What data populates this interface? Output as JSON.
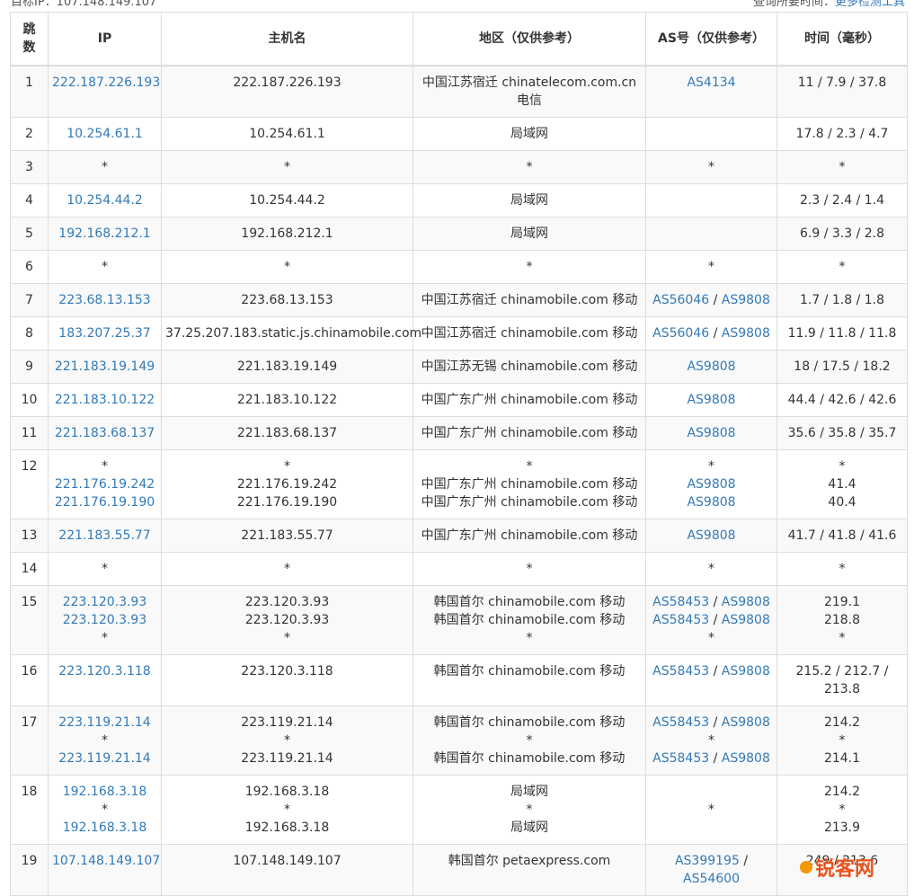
{
  "top": {
    "left_text": "目标IP：107.148.149.107",
    "right_text": "查询所要时间：",
    "right_link": "更多检测工具"
  },
  "headers": {
    "hop_line1": "跳",
    "hop_line2": "数",
    "ip": "IP",
    "host": "主机名",
    "region": "地区（仅供参考）",
    "as": "AS号（仅供参考）",
    "time": "时间（毫秒）"
  },
  "rows": [
    {
      "hop": "1",
      "ip": [
        "222.187.226.193"
      ],
      "host": [
        "222.187.226.193"
      ],
      "region": [
        "中国江苏宿迁 chinatelecom.com.cn",
        "电信"
      ],
      "as": [
        [
          "AS4134"
        ]
      ],
      "time": [
        "11 / 7.9 / 37.8"
      ]
    },
    {
      "hop": "2",
      "ip": [
        "10.254.61.1"
      ],
      "host": [
        "10.254.61.1"
      ],
      "region": [
        "局域网"
      ],
      "as": [
        []
      ],
      "time": [
        "17.8 / 2.3 / 4.7"
      ]
    },
    {
      "hop": "3",
      "ip": [
        "*"
      ],
      "host": [
        "*"
      ],
      "region": [
        "*"
      ],
      "as": [
        [
          "*"
        ]
      ],
      "time": [
        "*"
      ]
    },
    {
      "hop": "4",
      "ip": [
        "10.254.44.2"
      ],
      "host": [
        "10.254.44.2"
      ],
      "region": [
        "局域网"
      ],
      "as": [
        []
      ],
      "time": [
        "2.3 / 2.4 / 1.4"
      ]
    },
    {
      "hop": "5",
      "ip": [
        "192.168.212.1"
      ],
      "host": [
        "192.168.212.1"
      ],
      "region": [
        "局域网"
      ],
      "as": [
        []
      ],
      "time": [
        "6.9 / 3.3 / 2.8"
      ]
    },
    {
      "hop": "6",
      "ip": [
        "*"
      ],
      "host": [
        "*"
      ],
      "region": [
        "*"
      ],
      "as": [
        [
          "*"
        ]
      ],
      "time": [
        "*"
      ]
    },
    {
      "hop": "7",
      "ip": [
        "223.68.13.153"
      ],
      "host": [
        "223.68.13.153"
      ],
      "region": [
        "中国江苏宿迁 chinamobile.com 移动"
      ],
      "as": [
        [
          "AS56046",
          "AS9808"
        ]
      ],
      "time": [
        "1.7 / 1.8 / 1.8"
      ]
    },
    {
      "hop": "8",
      "ip": [
        "183.207.25.37"
      ],
      "host": [
        "37.25.207.183.static.js.chinamobile.com"
      ],
      "region": [
        "中国江苏宿迁 chinamobile.com 移动"
      ],
      "as": [
        [
          "AS56046",
          "AS9808"
        ]
      ],
      "time": [
        "11.9 / 11.8 / 11.8"
      ]
    },
    {
      "hop": "9",
      "ip": [
        "221.183.19.149"
      ],
      "host": [
        "221.183.19.149"
      ],
      "region": [
        "中国江苏无锡 chinamobile.com 移动"
      ],
      "as": [
        [
          "AS9808"
        ]
      ],
      "time": [
        "18 / 17.5 / 18.2"
      ]
    },
    {
      "hop": "10",
      "ip": [
        "221.183.10.122"
      ],
      "host": [
        "221.183.10.122"
      ],
      "region": [
        "中国广东广州 chinamobile.com 移动"
      ],
      "as": [
        [
          "AS9808"
        ]
      ],
      "time": [
        "44.4 / 42.6 / 42.6"
      ]
    },
    {
      "hop": "11",
      "ip": [
        "221.183.68.137"
      ],
      "host": [
        "221.183.68.137"
      ],
      "region": [
        "中国广东广州 chinamobile.com 移动"
      ],
      "as": [
        [
          "AS9808"
        ]
      ],
      "time": [
        "35.6 / 35.8 / 35.7"
      ]
    },
    {
      "hop": "12",
      "ip": [
        "*",
        "221.176.19.242",
        "221.176.19.190"
      ],
      "host": [
        "*",
        "221.176.19.242",
        "221.176.19.190"
      ],
      "region": [
        "*",
        "中国广东广州 chinamobile.com 移动",
        "中国广东广州 chinamobile.com 移动"
      ],
      "as": [
        [
          "*"
        ],
        [
          "AS9808"
        ],
        [
          "AS9808"
        ]
      ],
      "time": [
        "*",
        "41.4",
        "40.4"
      ]
    },
    {
      "hop": "13",
      "ip": [
        "221.183.55.77"
      ],
      "host": [
        "221.183.55.77"
      ],
      "region": [
        "中国广东广州 chinamobile.com 移动"
      ],
      "as": [
        [
          "AS9808"
        ]
      ],
      "time": [
        "41.7 / 41.8 / 41.6"
      ]
    },
    {
      "hop": "14",
      "ip": [
        "*"
      ],
      "host": [
        "*"
      ],
      "region": [
        "*"
      ],
      "as": [
        [
          "*"
        ]
      ],
      "time": [
        "*"
      ]
    },
    {
      "hop": "15",
      "ip": [
        "223.120.3.93",
        "223.120.3.93",
        "*"
      ],
      "host": [
        "223.120.3.93",
        "223.120.3.93",
        "*"
      ],
      "region": [
        "韩国首尔 chinamobile.com 移动",
        "韩国首尔 chinamobile.com 移动",
        "*"
      ],
      "as": [
        [
          "AS58453",
          "AS9808"
        ],
        [
          "AS58453",
          "AS9808"
        ],
        [
          "*"
        ]
      ],
      "time": [
        "219.1",
        "218.8",
        "*"
      ]
    },
    {
      "hop": "16",
      "ip": [
        "223.120.3.118"
      ],
      "host": [
        "223.120.3.118"
      ],
      "region": [
        "韩国首尔 chinamobile.com 移动"
      ],
      "as": [
        [
          "AS58453",
          "AS9808"
        ]
      ],
      "time": [
        "215.2 / 212.7 /",
        "213.8"
      ]
    },
    {
      "hop": "17",
      "ip": [
        "223.119.21.14",
        "*",
        "223.119.21.14"
      ],
      "host": [
        "223.119.21.14",
        "*",
        "223.119.21.14"
      ],
      "region": [
        "韩国首尔 chinamobile.com 移动",
        "*",
        "韩国首尔 chinamobile.com 移动"
      ],
      "as": [
        [
          "AS58453",
          "AS9808"
        ],
        [
          "*"
        ],
        [
          "AS58453",
          "AS9808"
        ]
      ],
      "time": [
        "214.2",
        "*",
        "214.1"
      ]
    },
    {
      "hop": "18",
      "ip": [
        "192.168.3.18",
        "*",
        "192.168.3.18"
      ],
      "host": [
        "192.168.3.18",
        "*",
        "192.168.3.18"
      ],
      "region": [
        "局域网",
        "*",
        "局域网"
      ],
      "as": [
        [],
        [
          "*"
        ],
        []
      ],
      "time": [
        "214.2",
        "*",
        "213.9"
      ]
    },
    {
      "hop": "19",
      "ip": [
        "107.148.149.107"
      ],
      "host": [
        "107.148.149.107"
      ],
      "region": [
        "韩国首尔 petaexpress.com"
      ],
      "as": [
        [
          "AS399195",
          "AS54600"
        ]
      ],
      "as_wrap": true,
      "time": [
        "249 / 213.6"
      ]
    }
  ],
  "watermark": {
    "text": "锐客网",
    "color": "#e8541c"
  },
  "colors": {
    "link": "#337ab7",
    "stripe": "#f9f9f9",
    "border": "#dddddd"
  }
}
